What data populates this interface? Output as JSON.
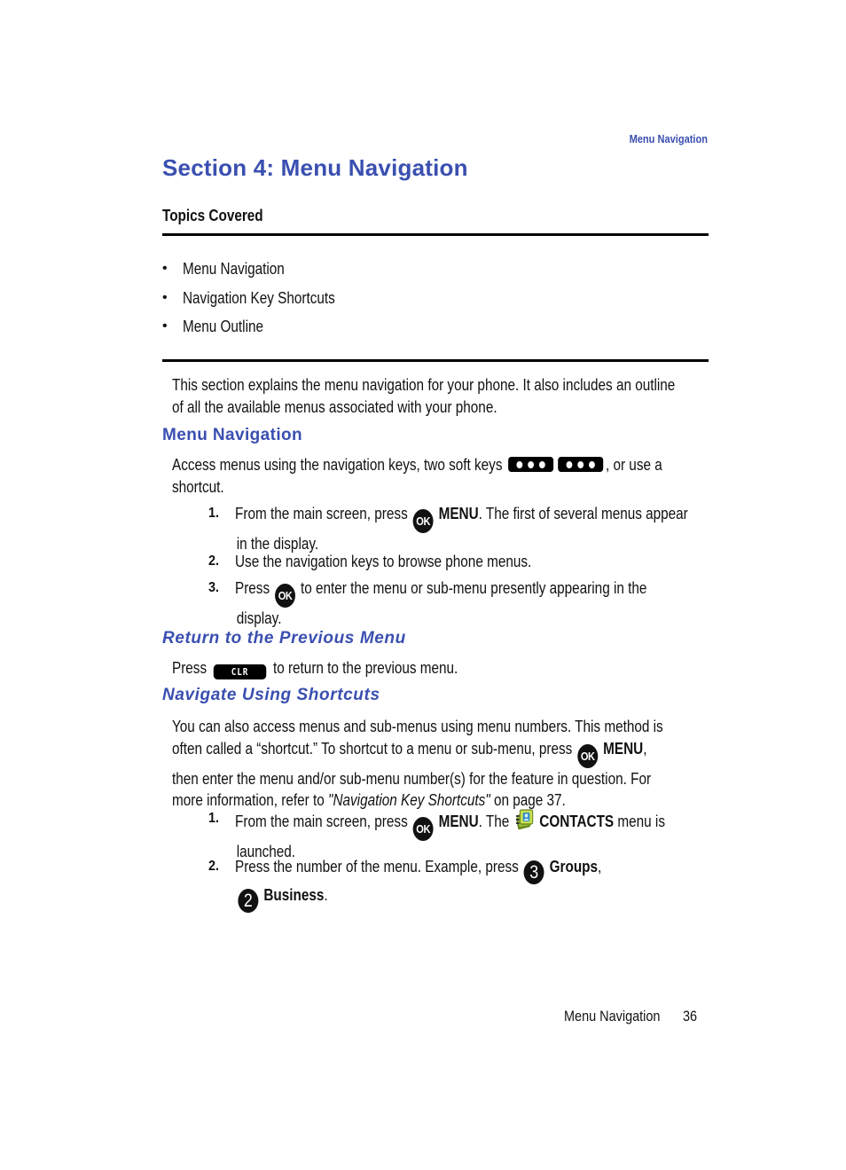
{
  "running_header": "Menu Navigation",
  "section_title": "Section 4: Menu Navigation",
  "topics": {
    "label": "Topics Covered",
    "items": [
      "Menu Navigation",
      "Navigation Key Shortcuts",
      "Menu Outline"
    ]
  },
  "intro": {
    "line1": "This section explains the menu navigation for your phone. It also includes an outline",
    "line2": "of all the available menus associated with your phone."
  },
  "menu_navigation": {
    "heading": "Menu Navigation",
    "para_line1_a": "Access menus using the navigation keys, two soft keys",
    "para_line1_b": ", or use a",
    "para_line2": "shortcut.",
    "steps": [
      {
        "num": "1.",
        "a": "From the main screen, press",
        "key": "OK",
        "bold": "MENU",
        "b": ". The first of several menus appear",
        "line2": "in the display."
      },
      {
        "num": "2.",
        "a": "Use the navigation keys to browse phone menus."
      },
      {
        "num": "3.",
        "a": "Press",
        "key": "OK",
        "b": "to enter the menu or sub-menu presently appearing in the",
        "line2": "display."
      }
    ]
  },
  "return_previous": {
    "heading": "Return to the Previous Menu",
    "press": "Press",
    "key": "CLR",
    "rest": "to return to the previous menu."
  },
  "shortcuts": {
    "heading": "Navigate Using Shortcuts",
    "line1": "You can also access menus and sub-menus using menu numbers. This method is",
    "line2_a": "often called a “shortcut.” To shortcut to a menu or sub-menu, press",
    "line2_key": "OK",
    "line2_bold": "MENU",
    "line2_b": ",",
    "line3": "then enter the menu and/or sub-menu number(s) for the feature in question. For",
    "line4_a": "more information, refer to ",
    "line4_link": "\"Navigation Key Shortcuts\"",
    "line4_b": "  on page 37.",
    "steps": [
      {
        "num": "1.",
        "a": "From the main screen, press",
        "key": "OK",
        "bold": "MENU",
        "b": ". The",
        "icon": "contacts-icon",
        "bold2": "CONTACTS",
        "c": "menu is",
        "line2": "launched."
      },
      {
        "num": "2.",
        "a": "Press the number of the menu. Example, press",
        "key1": "3",
        "bold1": "Groups",
        "b": ",",
        "key2": "2",
        "bold2": "Business",
        "c": "."
      }
    ]
  },
  "footer": {
    "title": "Menu Navigation",
    "page": "36"
  }
}
